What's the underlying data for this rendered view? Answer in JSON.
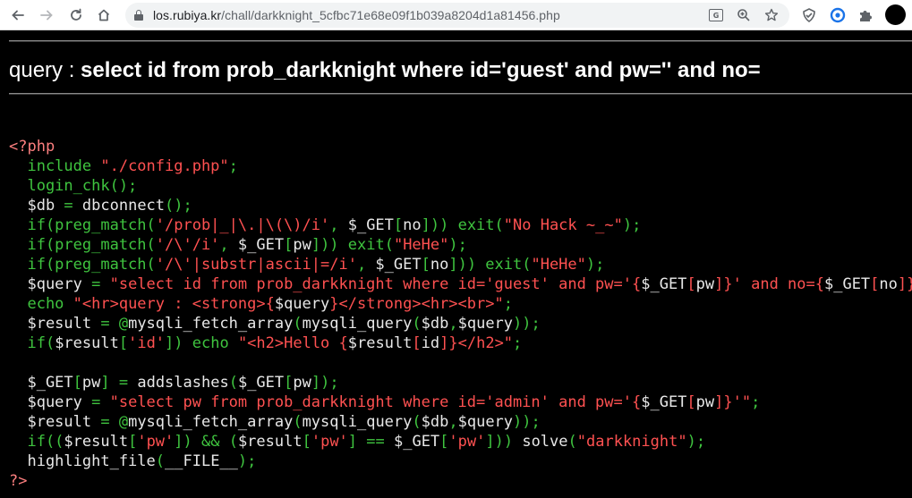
{
  "browser": {
    "url_host": "los.rubiya.kr",
    "url_path": "/chall/darkknight_5cfbc71e68e09f1b039a8204d1a81456.php",
    "back_icon": "arrow-left-icon",
    "forward_icon": "arrow-right-icon",
    "reload_icon": "reload-icon",
    "home_icon": "home-icon",
    "lock_icon": "lock-icon",
    "translate_icon": "translate-icon",
    "zoom_icon": "zoom-icon",
    "bookmark_icon": "star-icon",
    "extension_icons": [
      "shield-extension-icon",
      "chrome-extension-icon",
      "puzzle-icon"
    ],
    "profile_icon": "avatar"
  },
  "page": {
    "query_label": "query : ",
    "query_text": "select id from prob_darkknight where id='guest' and pw='' and no=",
    "code_lines": [
      [
        [
          "def",
          "<?php"
        ]
      ],
      [
        [
          "kw",
          "  include "
        ],
        [
          "str",
          "\"./config.php\""
        ],
        [
          "kw",
          ";"
        ]
      ],
      [
        [
          "kw",
          "  login_chk();"
        ]
      ],
      [
        [
          "var",
          "  $db "
        ],
        [
          "kw",
          "= "
        ],
        [
          "var",
          "dbconnect"
        ],
        [
          "kw",
          "();"
        ]
      ],
      [
        [
          "kw",
          "  if(preg_match("
        ],
        [
          "str",
          "'/prob|_|\\.|\\(\\)/i'"
        ],
        [
          "kw",
          ", "
        ],
        [
          "var",
          "$_GET"
        ],
        [
          "kw",
          "["
        ],
        [
          "var",
          "no"
        ],
        [
          "kw",
          "])) exit("
        ],
        [
          "str",
          "\"No Hack ~_~\""
        ],
        [
          "kw",
          ");"
        ]
      ],
      [
        [
          "kw",
          "  if(preg_match("
        ],
        [
          "str",
          "'/\\'/i'"
        ],
        [
          "kw",
          ", "
        ],
        [
          "var",
          "$_GET"
        ],
        [
          "kw",
          "["
        ],
        [
          "var",
          "pw"
        ],
        [
          "kw",
          "])) exit("
        ],
        [
          "str",
          "\"HeHe\""
        ],
        [
          "kw",
          ");"
        ]
      ],
      [
        [
          "kw",
          "  if(preg_match("
        ],
        [
          "str",
          "'/\\'|substr|ascii|=/i'"
        ],
        [
          "kw",
          ", "
        ],
        [
          "var",
          "$_GET"
        ],
        [
          "kw",
          "["
        ],
        [
          "var",
          "no"
        ],
        [
          "kw",
          "])) exit("
        ],
        [
          "str",
          "\"HeHe\""
        ],
        [
          "kw",
          ");"
        ]
      ],
      [
        [
          "var",
          "  $query "
        ],
        [
          "kw",
          "= "
        ],
        [
          "str",
          "\"select id from prob_darkknight where id='guest' and pw='{"
        ],
        [
          "var",
          "$_GET"
        ],
        [
          "str",
          "["
        ],
        [
          "var",
          "pw"
        ],
        [
          "str",
          "]}' and no={"
        ],
        [
          "var",
          "$_GET"
        ],
        [
          "str",
          "["
        ],
        [
          "var",
          "no"
        ],
        [
          "str",
          "]}\""
        ],
        [
          "kw",
          ";"
        ]
      ],
      [
        [
          "kw",
          "  echo "
        ],
        [
          "str",
          "\"<hr>query : <strong>{"
        ],
        [
          "var",
          "$query"
        ],
        [
          "str",
          "}</strong><hr><br>\""
        ],
        [
          "kw",
          ";"
        ]
      ],
      [
        [
          "var",
          "  $result "
        ],
        [
          "kw",
          "= @"
        ],
        [
          "var",
          "mysqli_fetch_array"
        ],
        [
          "kw",
          "("
        ],
        [
          "var",
          "mysqli_query"
        ],
        [
          "kw",
          "("
        ],
        [
          "var",
          "$db"
        ],
        [
          "kw",
          ","
        ],
        [
          "var",
          "$query"
        ],
        [
          "kw",
          "));"
        ]
      ],
      [
        [
          "kw",
          "  if("
        ],
        [
          "var",
          "$result"
        ],
        [
          "kw",
          "["
        ],
        [
          "str",
          "'id'"
        ],
        [
          "kw",
          "]) echo "
        ],
        [
          "str",
          "\"<h2>Hello {"
        ],
        [
          "var",
          "$result"
        ],
        [
          "str",
          "["
        ],
        [
          "var",
          "id"
        ],
        [
          "str",
          "]}</h2>\""
        ],
        [
          "kw",
          ";"
        ]
      ],
      [
        [
          "kw",
          ""
        ]
      ],
      [
        [
          "var",
          "  $_GET"
        ],
        [
          "kw",
          "["
        ],
        [
          "var",
          "pw"
        ],
        [
          "kw",
          "] = "
        ],
        [
          "var",
          "addslashes"
        ],
        [
          "kw",
          "("
        ],
        [
          "var",
          "$_GET"
        ],
        [
          "kw",
          "["
        ],
        [
          "var",
          "pw"
        ],
        [
          "kw",
          "]);"
        ]
      ],
      [
        [
          "var",
          "  $query "
        ],
        [
          "kw",
          "= "
        ],
        [
          "str",
          "\"select pw from prob_darkknight where id='admin' and pw='{"
        ],
        [
          "var",
          "$_GET"
        ],
        [
          "str",
          "["
        ],
        [
          "var",
          "pw"
        ],
        [
          "str",
          "]}'\""
        ],
        [
          "kw",
          ";"
        ]
      ],
      [
        [
          "var",
          "  $result "
        ],
        [
          "kw",
          "= @"
        ],
        [
          "var",
          "mysqli_fetch_array"
        ],
        [
          "kw",
          "("
        ],
        [
          "var",
          "mysqli_query"
        ],
        [
          "kw",
          "("
        ],
        [
          "var",
          "$db"
        ],
        [
          "kw",
          ","
        ],
        [
          "var",
          "$query"
        ],
        [
          "kw",
          "));"
        ]
      ],
      [
        [
          "kw",
          "  if(("
        ],
        [
          "var",
          "$result"
        ],
        [
          "kw",
          "["
        ],
        [
          "str",
          "'pw'"
        ],
        [
          "kw",
          "]) && ("
        ],
        [
          "var",
          "$result"
        ],
        [
          "kw",
          "["
        ],
        [
          "str",
          "'pw'"
        ],
        [
          "kw",
          "] == "
        ],
        [
          "var",
          "$_GET"
        ],
        [
          "kw",
          "["
        ],
        [
          "str",
          "'pw'"
        ],
        [
          "kw",
          "])) "
        ],
        [
          "var",
          "solve"
        ],
        [
          "kw",
          "("
        ],
        [
          "str",
          "\"darkknight\""
        ],
        [
          "kw",
          ");"
        ]
      ],
      [
        [
          "var",
          "  highlight_file"
        ],
        [
          "kw",
          "("
        ],
        [
          "var",
          "__FILE__"
        ],
        [
          "kw",
          ");"
        ]
      ],
      [
        [
          "def",
          "?>"
        ]
      ]
    ]
  },
  "colors": {
    "background": "#000000",
    "keyword": "#3fc43f",
    "string": "#ff5151",
    "default": "#fd7f7f",
    "variable": "#e8e8e8"
  }
}
